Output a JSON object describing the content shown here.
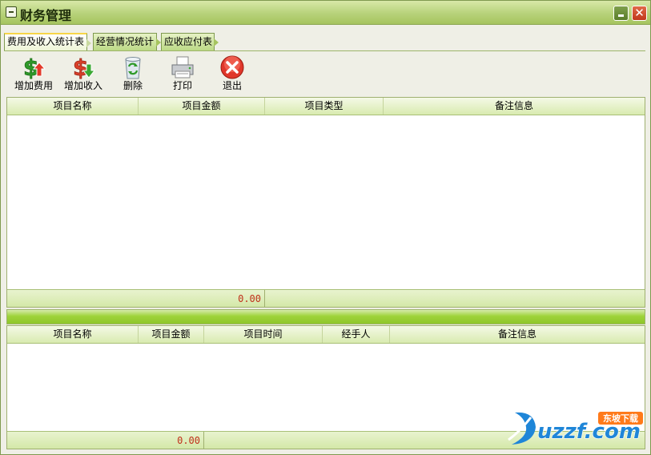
{
  "window": {
    "title": "财务管理"
  },
  "tabs": [
    {
      "label": "费用及收入统计表",
      "active": true
    },
    {
      "label": "经营情况统计",
      "active": false
    },
    {
      "label": "应收应付表",
      "active": false
    }
  ],
  "toolbar": [
    {
      "label": "增加费用",
      "icon": "dollar-up-icon"
    },
    {
      "label": "增加收入",
      "icon": "dollar-down-icon"
    },
    {
      "label": "删除",
      "icon": "recycle-bin-icon"
    },
    {
      "label": "打印",
      "icon": "printer-icon"
    },
    {
      "label": "退出",
      "icon": "exit-icon"
    }
  ],
  "grid_top": {
    "columns": [
      "项目名称",
      "项目金额",
      "项目类型",
      "备注信息"
    ],
    "rows": [],
    "total": "0.00"
  },
  "grid_bottom": {
    "columns": [
      "项目名称",
      "项目金额",
      "项目时间",
      "经手人",
      "备注信息"
    ],
    "rows": [],
    "total": "0.00"
  },
  "watermark": {
    "brand": "uzzf.com",
    "sub": "东坡下载"
  },
  "colors": {
    "accent_green": "#9ed33a",
    "total_red": "#c0301b",
    "active_tab_border": "#f7d548"
  }
}
